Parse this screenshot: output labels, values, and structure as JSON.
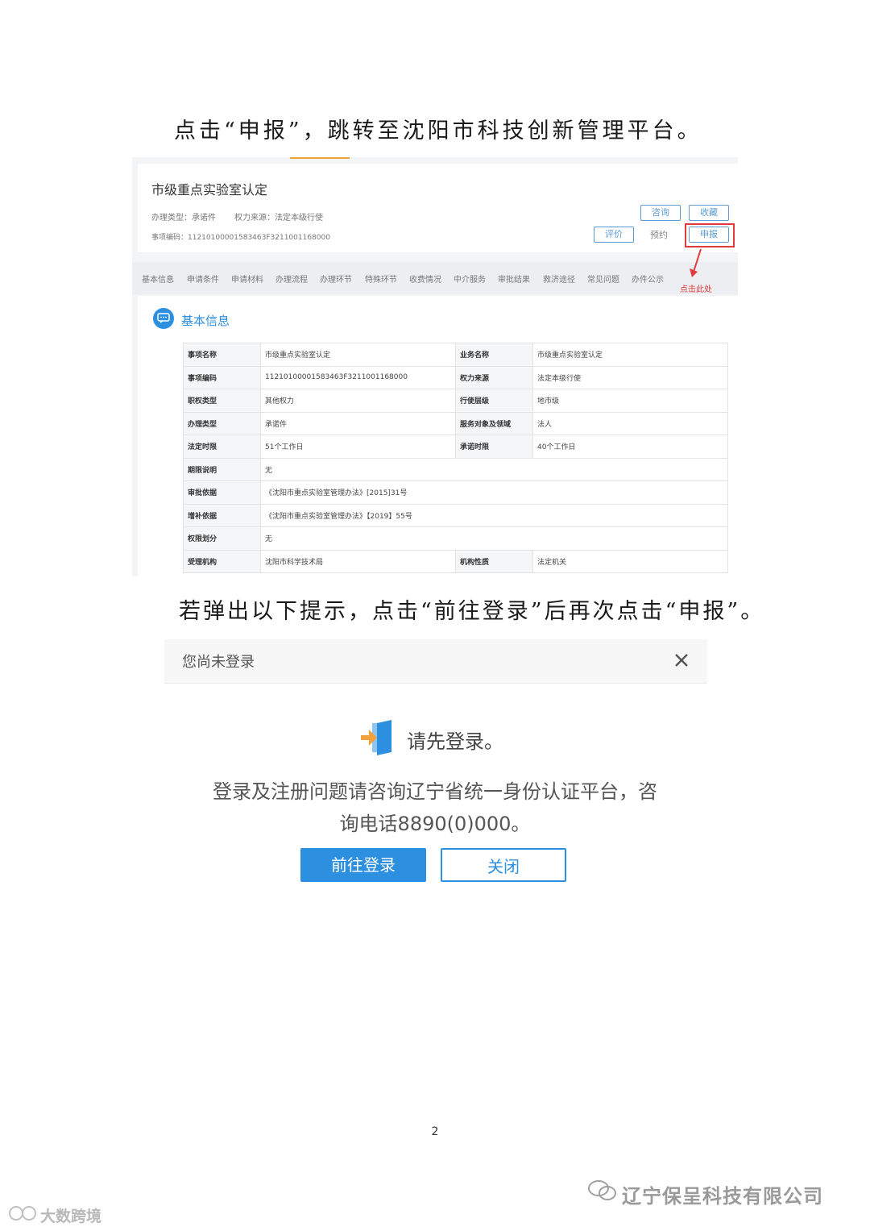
{
  "captions": {
    "step1": "点击“申报”，跳转至沈阳市科技创新管理平台。",
    "step2": "若弹出以下提示，点击“前往登录”后再次点击“申报”。"
  },
  "screenshot1": {
    "item_title": "市级重点实验室认定",
    "meta_type": "办理类型：承诺件",
    "meta_source": "权力来源：法定本级行使",
    "meta_code": "事项编码：11210100001583463F3211001168000",
    "buttons": {
      "consult": "咨询",
      "favorite": "收藏",
      "rate": "评价",
      "book": "预约",
      "apply": "申报"
    },
    "annotation": "点击此处",
    "tabs": [
      "基本信息",
      "申请条件",
      "申请材料",
      "办理流程",
      "办理环节",
      "特殊环节",
      "收费情况",
      "中介服务",
      "审批结果",
      "救济途径",
      "常见问题",
      "办件公示"
    ],
    "section_title": "基本信息",
    "rows": [
      {
        "l1": "事项名称",
        "v1": "市级重点实验室认定",
        "l2": "业务名称",
        "v2": "市级重点实验室认定"
      },
      {
        "l1": "事项编码",
        "v1": "11210100001583463F3211001168000",
        "l2": "权力来源",
        "v2": "法定本级行使"
      },
      {
        "l1": "职权类型",
        "v1": "其他权力",
        "l2": "行使层级",
        "v2": "地市级"
      },
      {
        "l1": "办理类型",
        "v1": "承诺件",
        "l2": "服务对象及领域",
        "v2": "法人"
      },
      {
        "l1": "法定时限",
        "v1": "51个工作日",
        "l2": "承诺时限",
        "v2": "40个工作日"
      },
      {
        "l1": "期限说明",
        "v1": "无"
      },
      {
        "l1": "审批依据",
        "v1": "《沈阳市重点实验室管理办法》[2015]31号"
      },
      {
        "l1": "增补依据",
        "v1": "《沈阳市重点实验室管理办法》【2019】55号"
      },
      {
        "l1": "权限划分",
        "v1": "无"
      },
      {
        "l1": "受理机构",
        "v1": "沈阳市科学技术局",
        "l2": "机构性质",
        "v2": "法定机关"
      }
    ]
  },
  "dialog": {
    "title": "您尚未登录",
    "prompt": "请先登录。",
    "message_line1": "登录及注册问题请咨询辽宁省统一身份认证平台，咨",
    "message_line2": "询电话8890(0)000。",
    "login_button": "前往登录",
    "close_button": "关闭"
  },
  "page_number": "2",
  "watermarks": {
    "company": "辽宁保呈科技有限公司",
    "source": "大数跨境"
  },
  "colors": {
    "accent": "#2d8fe0",
    "annotation_red": "#e13a3a"
  }
}
